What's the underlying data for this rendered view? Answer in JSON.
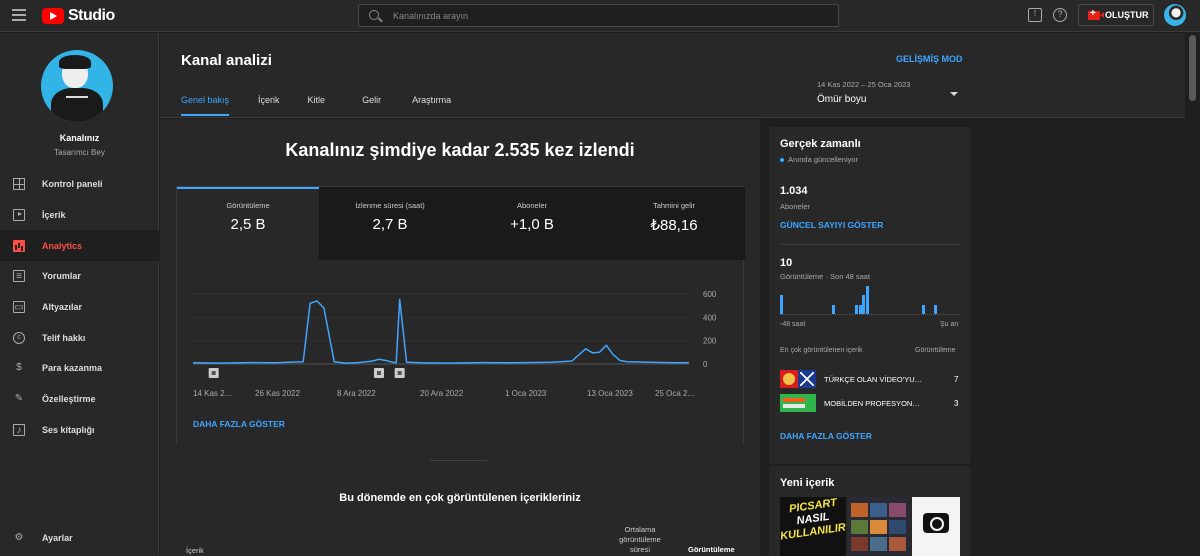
{
  "topbar": {
    "logo_text": "Studio",
    "search_placeholder": "Kanalınızda arayın",
    "create_label": "OLUŞTUR",
    "icons": [
      "menu-icon",
      "youtube-logo-icon",
      "search-icon",
      "feedback-icon",
      "help-icon",
      "create-video-icon",
      "account-avatar"
    ]
  },
  "sidebar": {
    "channel_name": "Kanalınız",
    "channel_sub": "Tasarımcı Bey",
    "items": [
      {
        "label": "Kontrol paneli",
        "icon": "dashboard-icon",
        "active": false
      },
      {
        "label": "İçerik",
        "icon": "content-icon",
        "active": false
      },
      {
        "label": "Analytics",
        "icon": "analytics-icon",
        "active": true
      },
      {
        "label": "Yorumlar",
        "icon": "comments-icon",
        "active": false
      },
      {
        "label": "Altyazılar",
        "icon": "subtitles-icon",
        "active": false
      },
      {
        "label": "Telif hakkı",
        "icon": "copyright-icon",
        "active": false
      },
      {
        "label": "Para kazanma",
        "icon": "monetization-icon",
        "active": false
      },
      {
        "label": "Özelleştirme",
        "icon": "customization-icon",
        "active": false
      },
      {
        "label": "Ses kitaplığı",
        "icon": "audio-library-icon",
        "active": false
      }
    ],
    "settings_label": "Ayarlar"
  },
  "header": {
    "title": "Kanal analizi",
    "advanced_mode": "GELİŞMİŞ MOD",
    "tabs": [
      {
        "label": "Genel bakış",
        "active": true
      },
      {
        "label": "İçerik",
        "active": false
      },
      {
        "label": "Kitle",
        "active": false
      },
      {
        "label": "Gelir",
        "active": false
      },
      {
        "label": "Araştırma",
        "active": false
      }
    ],
    "date_range": "14 Kas 2022 – 25 Oca 2023",
    "period": "Ömür boyu"
  },
  "overview": {
    "headline": "Kanalınız şimdiye kadar 2.535 kez izlendi",
    "metrics": [
      {
        "label": "Görüntüleme",
        "value": "2,5 B",
        "active": true
      },
      {
        "label": "İzlenme süresi (saat)",
        "value": "2,7 B",
        "active": false
      },
      {
        "label": "Aboneler",
        "value": "+1,0 B",
        "active": false
      },
      {
        "label": "Tahmini gelir",
        "value": "₺88,16",
        "active": false
      }
    ],
    "show_more": "DAHA FAZLA GÖSTER",
    "top_content_title": "Bu dönemde en çok görüntülenen içerikleriniz",
    "table_headers": {
      "content": "İçerik",
      "avg_duration": "Ortalama görüntüleme süresi",
      "views": "Görüntüleme"
    }
  },
  "chart_data": {
    "type": "line",
    "title": "",
    "x_tick_labels": [
      "14 Kas 2...",
      "26 Kas 2022",
      "8 Ara 2022",
      "20 Ara 2022",
      "1 Oca 2023",
      "13 Oca 2023",
      "25 Oca 2..."
    ],
    "y_ticks": [
      0,
      200,
      400,
      600
    ],
    "ylim": [
      0,
      600
    ],
    "grid": true,
    "color": "#3ea6ff",
    "x_range_days": [
      0,
      72
    ],
    "series": [
      {
        "values": [
          [
            0,
            10
          ],
          [
            4,
            8
          ],
          [
            8,
            12
          ],
          [
            12,
            10
          ],
          [
            14,
            15
          ],
          [
            16,
            20
          ],
          [
            17,
            520
          ],
          [
            18,
            540
          ],
          [
            19,
            480
          ],
          [
            20.5,
            20
          ],
          [
            22,
            8
          ],
          [
            24,
            12
          ],
          [
            26,
            25
          ],
          [
            27,
            40
          ],
          [
            28,
            30
          ],
          [
            29,
            15
          ],
          [
            29.5,
            10
          ],
          [
            30,
            555
          ],
          [
            31,
            15
          ],
          [
            33,
            10
          ],
          [
            37,
            8
          ],
          [
            42,
            12
          ],
          [
            47,
            10
          ],
          [
            52,
            15
          ],
          [
            55,
            25
          ],
          [
            57,
            130
          ],
          [
            58,
            95
          ],
          [
            59,
            100
          ],
          [
            60,
            160
          ],
          [
            61,
            80
          ],
          [
            62,
            30
          ],
          [
            63,
            20
          ],
          [
            66,
            15
          ],
          [
            70,
            10
          ],
          [
            72,
            12
          ]
        ]
      }
    ],
    "markers": [
      {
        "label": "video-marker",
        "x_day": 3
      },
      {
        "label": "video-marker",
        "x_day": 27
      },
      {
        "label": "video-marker",
        "x_day": 30
      }
    ]
  },
  "realtime": {
    "title": "Gerçek zamanlı",
    "live_label": "Anında güncelleniyor",
    "subscribers": "1.034",
    "subscribers_label": "Aboneler",
    "show_count": "GÜNCEL SAYIYI GÖSTER",
    "views": "10",
    "views_label": "Görüntüleme · Son 48 saat",
    "bars": [
      {
        "hour": 0,
        "value": 2
      },
      {
        "hour": 14,
        "value": 1
      },
      {
        "hour": 20,
        "value": 1
      },
      {
        "hour": 21,
        "value": 1
      },
      {
        "hour": 22,
        "value": 2
      },
      {
        "hour": 23,
        "value": 3
      },
      {
        "hour": 38,
        "value": 1
      },
      {
        "hour": 41,
        "value": 1
      }
    ],
    "axis_start": "-48 saat",
    "axis_end": "Şu an",
    "top_head": "En çok görüntülenen içerik",
    "top_head_metric": "Görüntüleme",
    "top_items": [
      {
        "title": "TÜRKÇE OLAN VİDEO'YU İNGİ...",
        "views": "7"
      },
      {
        "title": "MOBİLDEN PROFESYONEL O...",
        "views": "3"
      }
    ],
    "show_more": "DAHA FAZLA GÖSTER"
  },
  "new_content": {
    "title": "Yeni içerik",
    "thumb_text": [
      "PICSART",
      "NASIL",
      "KULLANILIR"
    ]
  }
}
